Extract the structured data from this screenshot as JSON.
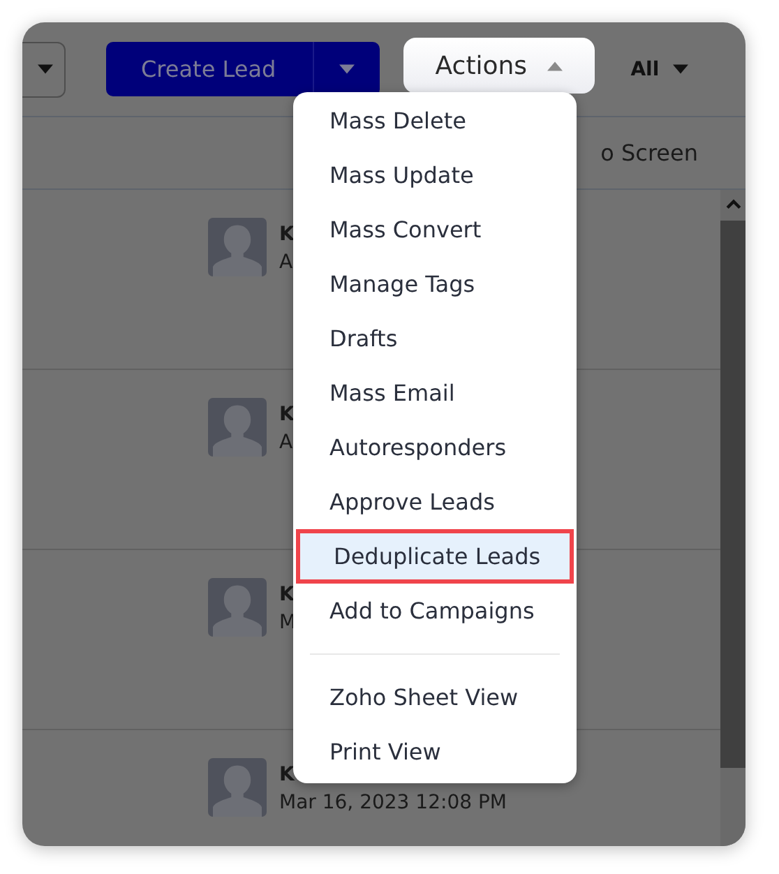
{
  "toolbar": {
    "create_button": {
      "label": "Create Lead"
    },
    "actions_button": {
      "label": "Actions",
      "expanded": true
    },
    "filter": {
      "label": "All"
    }
  },
  "subheader": {
    "text": "o Screen"
  },
  "records": [
    {
      "name": "K",
      "detail": "A"
    },
    {
      "name": "K",
      "detail": "A"
    },
    {
      "name": "K",
      "detail": "M"
    },
    {
      "name": "K",
      "detail": "Mar 16, 2023 12:08 PM"
    }
  ],
  "actions_menu": [
    {
      "kind": "item",
      "label": "Mass Delete",
      "selected": false
    },
    {
      "kind": "item",
      "label": "Mass Update",
      "selected": false
    },
    {
      "kind": "item",
      "label": "Mass Convert",
      "selected": false
    },
    {
      "kind": "item",
      "label": "Manage Tags",
      "selected": false
    },
    {
      "kind": "item",
      "label": "Drafts",
      "selected": false
    },
    {
      "kind": "item",
      "label": "Mass Email",
      "selected": false
    },
    {
      "kind": "item",
      "label": "Autoresponders",
      "selected": false
    },
    {
      "kind": "item",
      "label": "Approve Leads",
      "selected": false
    },
    {
      "kind": "item",
      "label": "Deduplicate Leads",
      "selected": true
    },
    {
      "kind": "item",
      "label": "Add to Campaigns",
      "selected": false
    },
    {
      "kind": "divider"
    },
    {
      "kind": "item",
      "label": "Zoho Sheet View",
      "selected": false
    },
    {
      "kind": "item",
      "label": "Print View",
      "selected": false
    }
  ]
}
